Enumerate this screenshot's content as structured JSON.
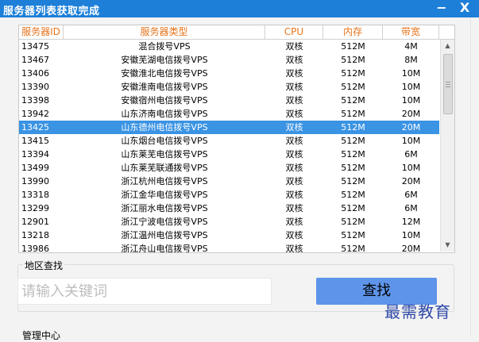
{
  "window": {
    "title": "服务器列表获取完成",
    "minimize_label": "−",
    "close_label": "X"
  },
  "table": {
    "columns": [
      "服务器ID",
      "服务器类型",
      "CPU",
      "内存",
      "带宽"
    ],
    "selected_row_index": 6,
    "rows": [
      {
        "id": "13475",
        "type": "混合拨号VPS",
        "cpu": "双核",
        "memory": "512M",
        "bandwidth": "4M"
      },
      {
        "id": "13467",
        "type": "安徽芜湖电信拨号VPS",
        "cpu": "双核",
        "memory": "512M",
        "bandwidth": "8M"
      },
      {
        "id": "13406",
        "type": "安徽淮北电信拨号VPS",
        "cpu": "双核",
        "memory": "512M",
        "bandwidth": "10M"
      },
      {
        "id": "13390",
        "type": "安徽淮南电信拨号VPS",
        "cpu": "双核",
        "memory": "512M",
        "bandwidth": "10M"
      },
      {
        "id": "13398",
        "type": "安徽宿州电信拨号VPS",
        "cpu": "双核",
        "memory": "512M",
        "bandwidth": "10M"
      },
      {
        "id": "13942",
        "type": "山东济南电信拨号VPS",
        "cpu": "双核",
        "memory": "512M",
        "bandwidth": "20M"
      },
      {
        "id": "13425",
        "type": "山东德州电信拨号VPS",
        "cpu": "双核",
        "memory": "512M",
        "bandwidth": "20M"
      },
      {
        "id": "13415",
        "type": "山东烟台电信拨号VPS",
        "cpu": "双核",
        "memory": "512M",
        "bandwidth": "10M"
      },
      {
        "id": "13394",
        "type": "山东莱芜电信拨号VPS",
        "cpu": "双核",
        "memory": "512M",
        "bandwidth": "6M"
      },
      {
        "id": "13499",
        "type": "山东莱芜联通拨号VPS",
        "cpu": "双核",
        "memory": "512M",
        "bandwidth": "10M"
      },
      {
        "id": "13990",
        "type": "浙江杭州电信拨号VPS",
        "cpu": "双核",
        "memory": "512M",
        "bandwidth": "20M"
      },
      {
        "id": "13318",
        "type": "浙江金华电信拨号VPS",
        "cpu": "双核",
        "memory": "512M",
        "bandwidth": "6M"
      },
      {
        "id": "13299",
        "type": "浙江丽水电信拨号VPS",
        "cpu": "双核",
        "memory": "512M",
        "bandwidth": "6M"
      },
      {
        "id": "12901",
        "type": "浙江宁波电信拨号VPS",
        "cpu": "双核",
        "memory": "512M",
        "bandwidth": "12M"
      },
      {
        "id": "13218",
        "type": "浙江温州电信拨号VPS",
        "cpu": "双核",
        "memory": "512M",
        "bandwidth": "10M"
      },
      {
        "id": "13986",
        "type": "浙江舟山电信拨号VPS",
        "cpu": "双核",
        "memory": "512M",
        "bandwidth": "20M"
      }
    ]
  },
  "search": {
    "group_label": "地区查找",
    "input_placeholder": "请输入关键词",
    "input_value": "",
    "button_label": "查找"
  },
  "watermark": "最需教育",
  "management": {
    "group_label": "管理中心"
  },
  "colors": {
    "titlebar": "#1d7fd8",
    "header_text": "#e6741c",
    "selected_row": "#3a93e3",
    "search_button": "#5e94ea",
    "watermark": "#2f49a8"
  }
}
